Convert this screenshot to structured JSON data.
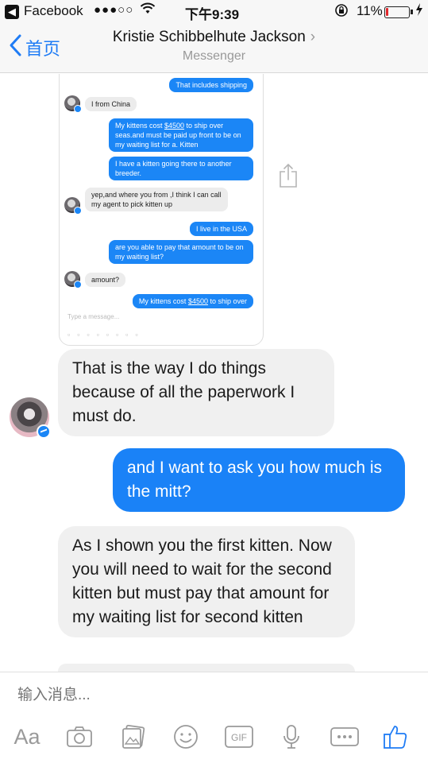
{
  "status_bar": {
    "back_app": "Facebook",
    "signal": "●●●○○",
    "time": "下午9:39",
    "battery_percent": "11%",
    "battery_level": 0.11,
    "battery_color": "#e3262b"
  },
  "nav": {
    "back_label": "首页",
    "title": "Kristie Schibbelhute Jackson",
    "subtitle": "Messenger",
    "accent": "#1f7cf5"
  },
  "embedded_screenshot": {
    "messages": [
      {
        "dir": "out",
        "text": "That includes shipping"
      },
      {
        "dir": "in",
        "text": "I from China"
      },
      {
        "dir": "out",
        "parts": [
          "My kittens cost ",
          "$4500",
          " to ship over seas.and must be paid up front to be on my waiting list for a. Kitten"
        ]
      },
      {
        "dir": "out",
        "text": "I have a kitten going there to another breeder."
      },
      {
        "dir": "in",
        "text": "yep,and where you from ,I think I can call my agent to pick kitten up"
      },
      {
        "dir": "out",
        "text": "I live in the USA"
      },
      {
        "dir": "out",
        "text": "are you able to pay that amount to be on my waiting list?"
      },
      {
        "dir": "in",
        "text": "amount?"
      },
      {
        "dir": "out",
        "parts": [
          "My kittens cost ",
          "$4500",
          " to ship over"
        ]
      }
    ],
    "input_placeholder": "Type a message..."
  },
  "messages": [
    {
      "dir": "in",
      "text": "That is the way I do things because of all the paperwork I must do."
    },
    {
      "dir": "out",
      "text": "and I want to ask you how much is the mitt?"
    },
    {
      "dir": "in",
      "text": "As I shown you the first kitten. Now you will need to wait for the second kitten but must pay that amount for my waiting list for second kitten"
    }
  ],
  "composer": {
    "placeholder": "输入消息...",
    "tools": [
      "Aa",
      "camera-icon",
      "gallery-icon",
      "emoji-icon",
      "gif-icon",
      "microphone-icon",
      "more-icon",
      "thumbs-up-icon"
    ]
  },
  "colors": {
    "outgoing_bubble": "#1a82f7",
    "incoming_bubble": "#f0f0f0"
  }
}
